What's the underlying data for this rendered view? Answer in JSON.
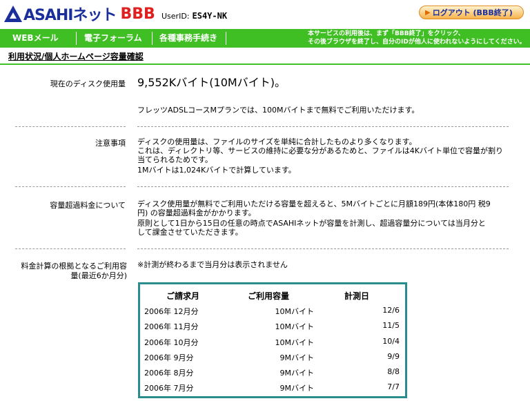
{
  "header": {
    "logo_text": "ASAHIネット",
    "logo_bbb": "BBB",
    "userid_label": "UserID:",
    "userid_value": "ES4Y-NK",
    "logout_label": "ログアウト (BBB終了)"
  },
  "nav": {
    "items": [
      "WEBメール",
      "電子フォーラム",
      "各種事務手続き"
    ],
    "notice_line1": "本サービスの利用後は、まず「BBB終了」をクリック、",
    "notice_line2": "その後ブラウザを終了し、自分のIDが他人に使われないようにしてください。"
  },
  "page": {
    "subtitle": "利用状況/個人ホームページ容量確認"
  },
  "sections": {
    "disk": {
      "label": "現在のディスク使用量",
      "value": "9,552Kバイト(10Mバイト)。",
      "note": "フレッツADSLコースMプランでは、100Mバイトまで無料でご利用いただけます。"
    },
    "caution": {
      "label": "注意事項",
      "line1": "ディスクの使用量は、ファイルのサイズを単純に合計したものより多くなります。",
      "line2": "これは、ディレクトリ等、サービスの維持に必要な分があるためと、ファイルは4Kバイト単位で容量が割り",
      "line3": "当てられるためです。",
      "line4": "1Mバイトは1,024Kバイトで計算しています。"
    },
    "overage": {
      "label": "容量超過料金について",
      "line1": "ディスク使用量が無料でご利用いただける容量を超えると、5Mバイトごとに月額189円(本体180円 税9",
      "line2": "円) の容量超過料金がかかります。",
      "line3": "原則として1日から15日の任意の時点でASAHIネットが容量を計測し、超過容量分については当月分と",
      "line4": "して課金させていただきます。"
    },
    "billing": {
      "label_line1": "料金計算の根拠となるご利用容",
      "label_line2": "量(最近6か月分)",
      "note": "※計測が終わるまで当月分は表示されません"
    }
  },
  "usage_table": {
    "headers": [
      "ご請求月",
      "ご利用容量",
      "計測日"
    ],
    "rows": [
      [
        "2006年 12月分",
        "10Mバイト",
        "12/6"
      ],
      [
        "2006年 11月分",
        "10Mバイト",
        "11/5"
      ],
      [
        "2006年 10月分",
        "10Mバイト",
        "10/4"
      ],
      [
        "2006年 9月分",
        "9Mバイト",
        "9/9"
      ],
      [
        "2006年 8月分",
        "9Mバイト",
        "8/8"
      ],
      [
        "2006年 7月分",
        "9Mバイト",
        "7/7"
      ]
    ]
  }
}
